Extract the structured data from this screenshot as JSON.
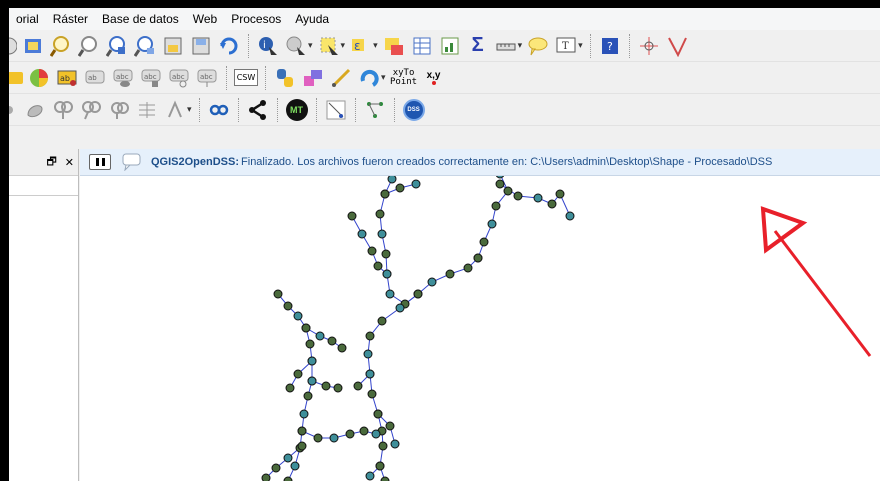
{
  "menu": [
    "orial",
    "Ráster",
    "Base de datos",
    "Web",
    "Procesos",
    "Ayuda"
  ],
  "toolbar1": {
    "sum_label": "Σ"
  },
  "toolbar2": {
    "csw_label": "CSW",
    "xytopoint_line1": "xyTo",
    "xytopoint_line2": "Point",
    "xy_label": "x,y"
  },
  "toolbar3": {
    "mt_label": "MT",
    "dss_label": "DSS"
  },
  "panel": {
    "float_label": "🗗",
    "close_label": "✕"
  },
  "message": {
    "title": "QGIS2OpenDSS:",
    "text": "Finalizado. Los archivos fueron creados correctamente en: C:\\Users\\admin\\Desktop\\Shape - Procesado\\DSS"
  },
  "colors": {
    "message_text": "#1e4f8a",
    "line": "#3344cc",
    "node_fill": "#4a6a3c",
    "node_fill_alt": "#3f8f9a",
    "arrow": "#e8202a"
  }
}
